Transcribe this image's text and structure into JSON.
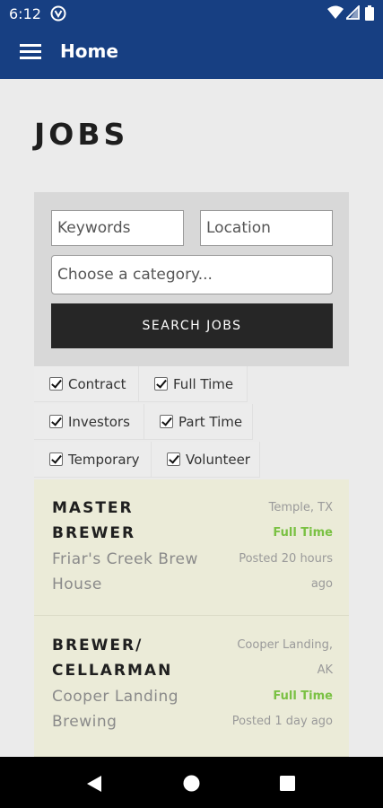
{
  "status_bar": {
    "time": "6:12",
    "icons": [
      "vpn-icon",
      "wifi-icon",
      "signal-icon",
      "battery-icon"
    ]
  },
  "app_bar": {
    "title": "Home",
    "menu_icon": "menu-icon"
  },
  "page": {
    "title": "JOBS"
  },
  "search": {
    "keywords_placeholder": "Keywords",
    "location_placeholder": "Location",
    "category_placeholder": "Choose a category...",
    "button_label": "SEARCH JOBS"
  },
  "filters": [
    {
      "label": "Contract",
      "checked": true
    },
    {
      "label": "Full Time",
      "checked": true
    },
    {
      "label": "Investors",
      "checked": true
    },
    {
      "label": "Part Time",
      "checked": true
    },
    {
      "label": "Temporary",
      "checked": true
    },
    {
      "label": "Volunteer",
      "checked": true
    }
  ],
  "jobs": [
    {
      "title_line1": "MASTER",
      "title_line2": "BREWER",
      "company_line1": "Friar's Creek Brew",
      "company_line2": "House",
      "location_line1": "Temple, TX",
      "type": "Full Time",
      "posted_line1": "Posted 20 hours",
      "posted_line2": "ago"
    },
    {
      "title_line1": "BREWER/",
      "title_line2": "CELLARMAN",
      "company_line1": "Cooper Landing",
      "company_line2": "Brewing",
      "location_line1": "Cooper Landing,",
      "location_line2": "AK",
      "type": "Full Time",
      "posted_line1": "Posted 1 day ago"
    }
  ],
  "colors": {
    "primary": "#173f82",
    "job_type": "#7ac143",
    "job_card_bg": "#ebebd8",
    "button_bg": "#262626"
  },
  "nav_bar": {
    "icons": [
      "back-icon",
      "home-icon",
      "recents-icon"
    ]
  }
}
